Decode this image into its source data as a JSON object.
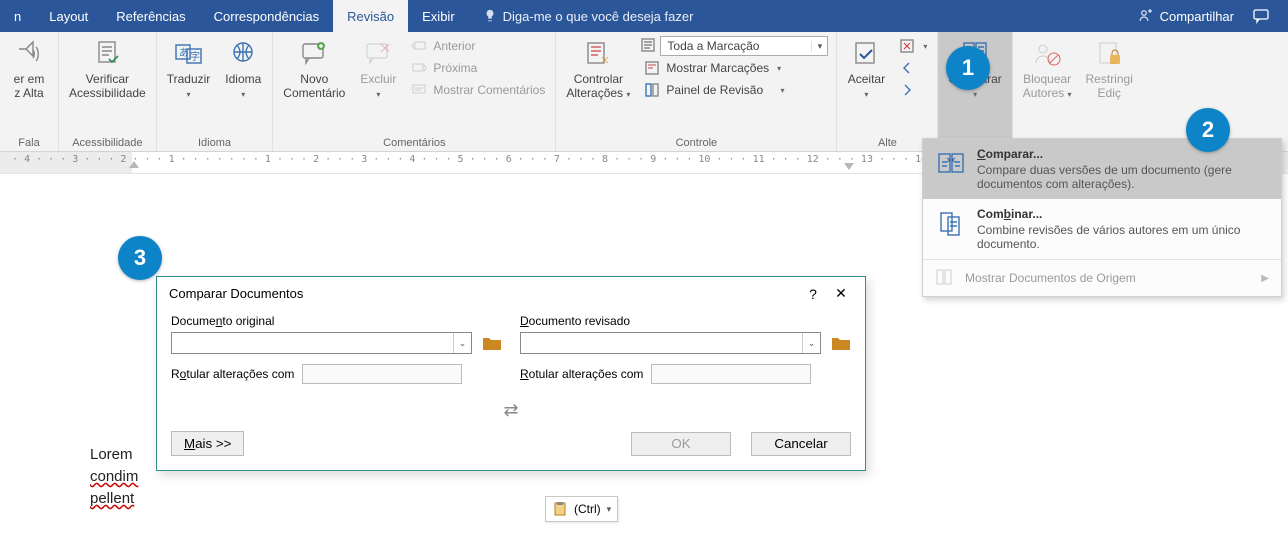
{
  "tabs": {
    "items": [
      "n",
      "Layout",
      "Referências",
      "Correspondências",
      "Revisão",
      "Exibir"
    ],
    "active_index": 4,
    "tell_me": "Diga-me o que você deseja fazer",
    "share": "Compartilhar"
  },
  "ribbon": {
    "g_voice": {
      "label": "Fala",
      "btn1_l1": "er em",
      "btn1_l2": "z Alta"
    },
    "g_access": {
      "label": "Acessibilidade",
      "btn": "Verificar\nAcessibilidade"
    },
    "g_lang": {
      "label": "Idioma",
      "btn_translate": "Traduzir",
      "btn_language": "Idioma"
    },
    "g_comments": {
      "label": "Comentários",
      "btn_new": "Novo\nComentário",
      "btn_delete": "Excluir",
      "btn_prev": "Anterior",
      "btn_next": "Próxima",
      "btn_show": "Mostrar Comentários"
    },
    "g_tracking": {
      "label": "Controle",
      "btn_track": "Controlar\nAlterações",
      "dd_display": "Toda a Marcação",
      "btn_show_markup": "Mostrar Marcações",
      "btn_review_pane": "Painel de Revisão"
    },
    "g_changes": {
      "label": "Alte",
      "btn_accept": "Aceitar"
    },
    "g_compare": {
      "label": "",
      "btn_compare": "Comparar"
    },
    "g_protect": {
      "btn_block": "Bloquear\nAutores",
      "btn_restrict": "Restringi\nEdiç"
    }
  },
  "menu": {
    "compare_title_pre": "C",
    "compare_title_rest": "omparar...",
    "compare_desc": "Compare duas versões de um documento (gere documentos com alterações).",
    "combine_title_pre": "Com",
    "combine_title_u": "b",
    "combine_title_rest": "inar...",
    "combine_desc": "Combine revisões de vários autores em um único documento.",
    "footer": "Mostrar Documentos de Origem"
  },
  "dialog": {
    "title": "Comparar Documentos",
    "orig_label_pre": "Docume",
    "orig_label_u": "n",
    "orig_label_rest": "to original",
    "rev_label_u": "D",
    "rev_label_rest": "ocumento revisado",
    "orig_changes_pre": "R",
    "orig_changes_u": "o",
    "orig_changes_rest": "tular alterações com",
    "rev_changes_u": "R",
    "rev_changes_rest": "otular alterações com",
    "orig_value": "",
    "rev_value": "",
    "orig_changes_value": "",
    "rev_changes_value": "",
    "more_u": "M",
    "more_rest": "ais >>",
    "ok": "OK",
    "cancel": "Cancelar"
  },
  "doc": {
    "l1": "Lorem",
    "l2": "condim",
    "l3": "pellent"
  },
  "paste": {
    "label": "(Ctrl)"
  },
  "badges": {
    "b1": "1",
    "b2": "2",
    "b3": "3"
  }
}
